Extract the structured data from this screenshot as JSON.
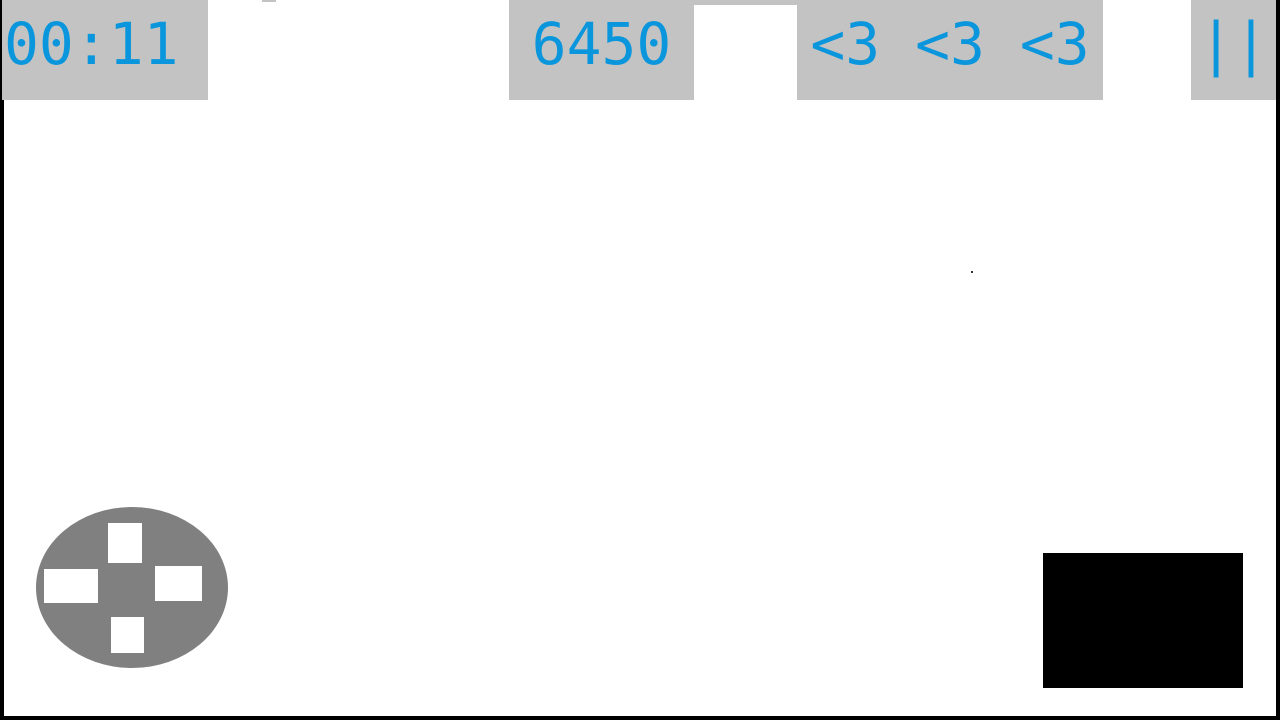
{
  "hud": {
    "timer": "00:11",
    "score": "6450",
    "lives": "<3 <3 <3",
    "pause_label": "||"
  },
  "colors": {
    "hud_text": "#0a96dc",
    "hud_background": "#c3c3c3",
    "playfield": "#ffffff",
    "dpad": "#808080",
    "action_button": "#000000"
  },
  "controls": {
    "dpad_icon": "dpad-icon",
    "action_icon": "action-button"
  }
}
